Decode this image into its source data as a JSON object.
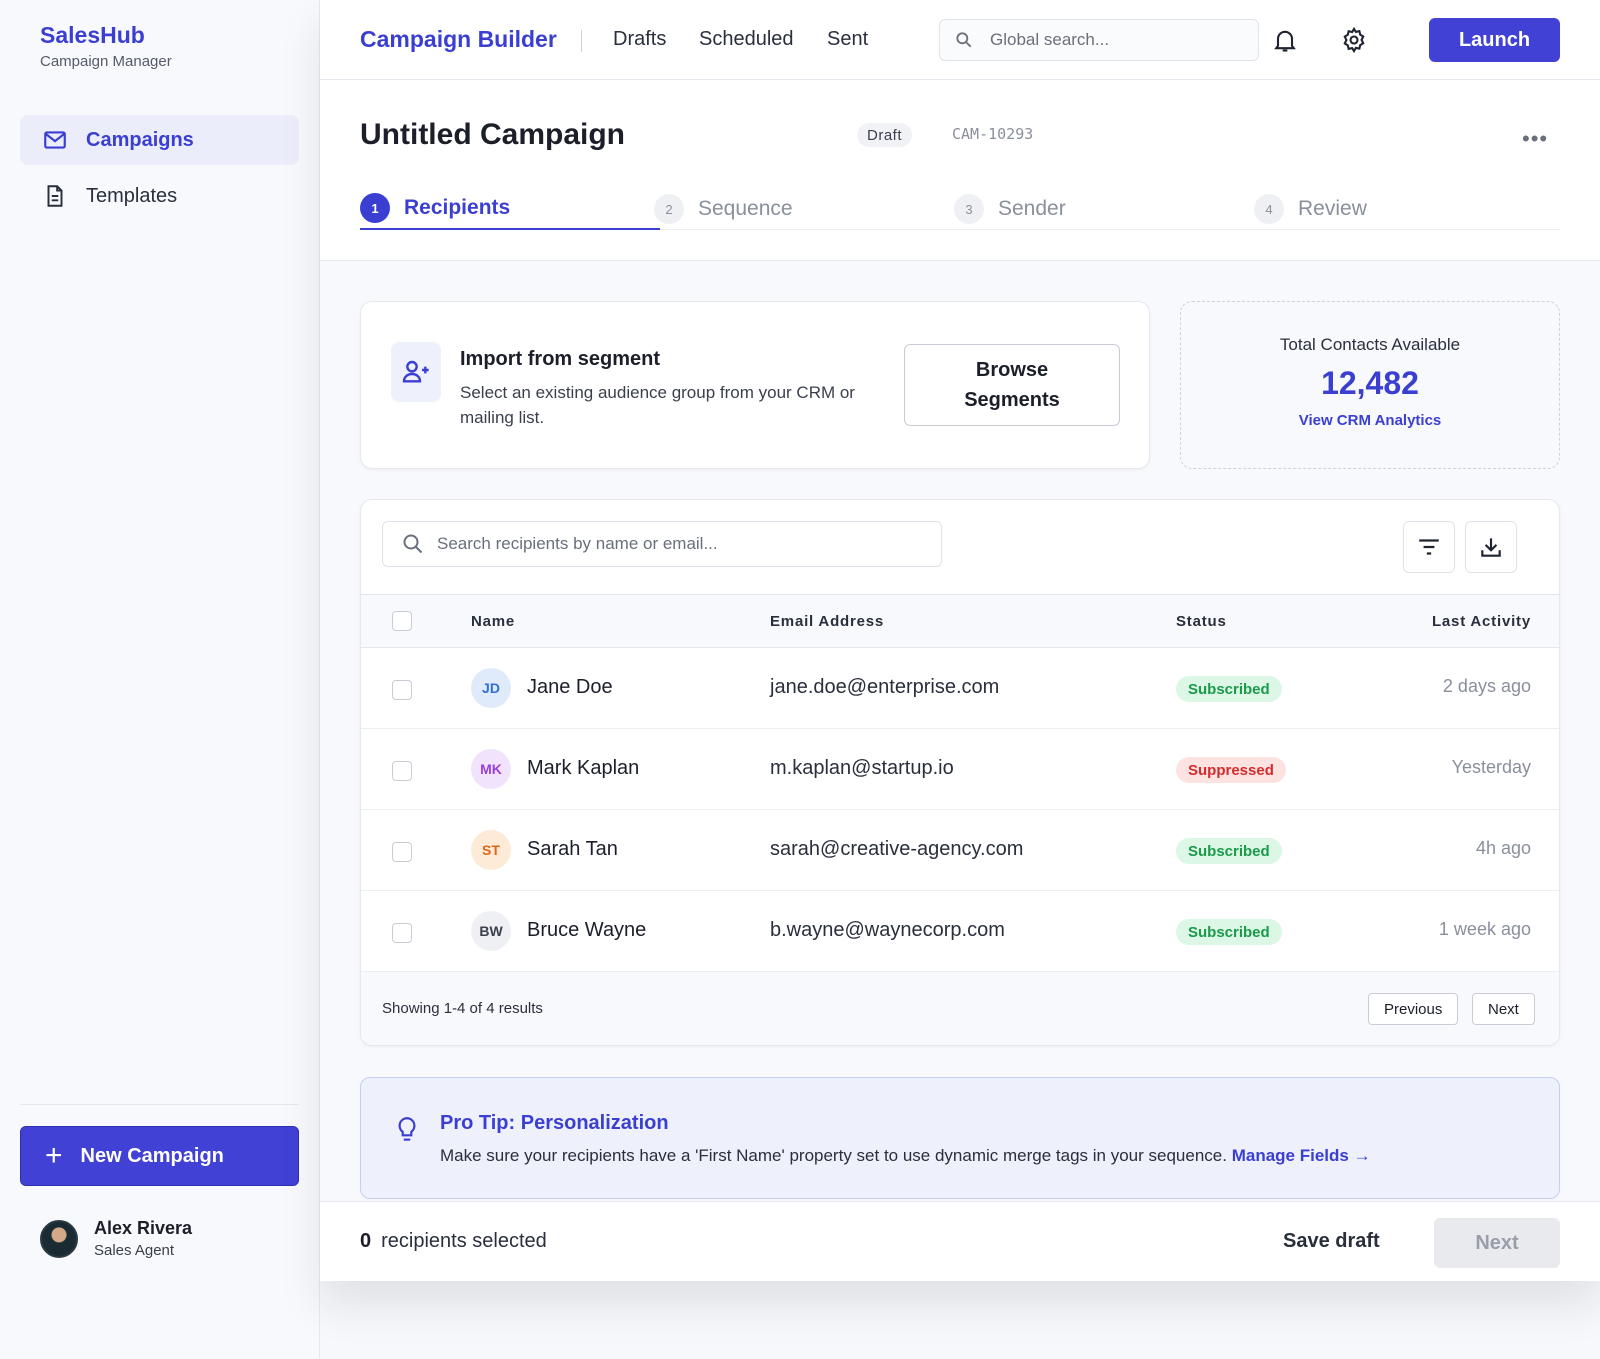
{
  "sidebar": {
    "brand": "SalesHub",
    "subtitle": "Campaign Manager",
    "items": [
      {
        "label": "Campaigns",
        "icon": "mail-icon",
        "active": true
      },
      {
        "label": "Templates",
        "icon": "document-icon",
        "active": false
      }
    ],
    "new_campaign_label": "New Campaign",
    "user": {
      "name": "Alex Rivera",
      "role": "Sales Agent"
    }
  },
  "topbar": {
    "title": "Campaign Builder",
    "links": [
      "Drafts",
      "Scheduled",
      "Sent"
    ],
    "search_placeholder": "Global search...",
    "launch_label": "Launch"
  },
  "header": {
    "title": "Untitled Campaign",
    "status": "Draft",
    "campaign_id": "CAM-10293",
    "more": "•••",
    "steps": [
      {
        "num": "1",
        "label": "Recipients",
        "active": true
      },
      {
        "num": "2",
        "label": "Sequence",
        "active": false
      },
      {
        "num": "3",
        "label": "Sender",
        "active": false
      },
      {
        "num": "4",
        "label": "Review",
        "active": false
      }
    ]
  },
  "import": {
    "title": "Import from segment",
    "description": "Select an existing audience group from your CRM or mailing list.",
    "button_label": "Browse Segments"
  },
  "contacts": {
    "label": "Total Contacts Available",
    "value": "12,482",
    "link": "View CRM Analytics"
  },
  "table": {
    "search_placeholder": "Search recipients by name or email...",
    "columns": [
      "Name",
      "Email Address",
      "Status",
      "Last Activity"
    ],
    "rows": [
      {
        "initials": "JD",
        "name": "Jane Doe",
        "email": "jane.doe@enterprise.com",
        "status": "Subscribed",
        "activity": "2 days ago"
      },
      {
        "initials": "MK",
        "name": "Mark Kaplan",
        "email": "m.kaplan@startup.io",
        "status": "Suppressed",
        "activity": "Yesterday"
      },
      {
        "initials": "ST",
        "name": "Sarah Tan",
        "email": "sarah@creative-agency.com",
        "status": "Subscribed",
        "activity": "4h ago"
      },
      {
        "initials": "BW",
        "name": "Bruce Wayne",
        "email": "b.wayne@waynecorp.com",
        "status": "Subscribed",
        "activity": "1 week ago"
      }
    ],
    "showing": "Showing 1-4 of 4 results",
    "prev_label": "Previous",
    "next_label": "Next"
  },
  "tip": {
    "title": "Pro Tip: Personalization",
    "text": "Make sure your recipients have a 'First Name' property set to use dynamic merge tags in your sequence.",
    "link": "Manage Fields →"
  },
  "bottombar": {
    "selected_count": "0",
    "selected_label": "recipients selected",
    "save_label": "Save draft",
    "next_label": "Next"
  },
  "colors": {
    "accent": "#3b3fd1",
    "subscribed_bg": "#dcf7e5",
    "subscribed_fg": "#1a9a4a",
    "suppressed_bg": "#fde2e2",
    "suppressed_fg": "#d42c2c"
  }
}
